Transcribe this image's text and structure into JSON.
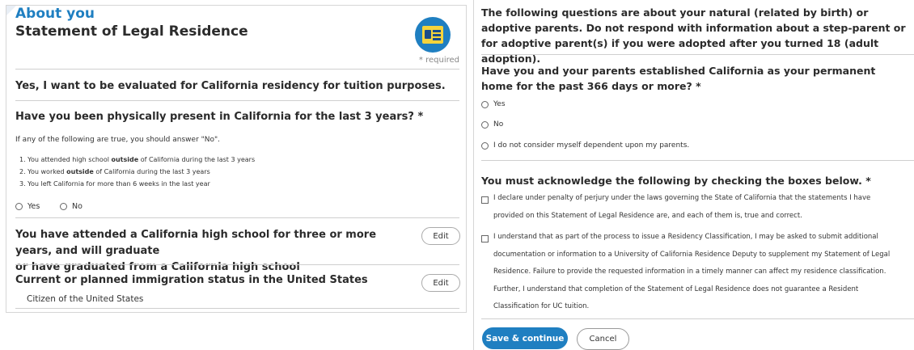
{
  "left": {
    "section_title": "About you",
    "page_title": "Statement of Legal Residence",
    "required_note": "* required",
    "evaluate_text": "Yes, I want to be evaluated for California residency for tuition purposes.",
    "q1": {
      "title": "Have you been physically present in California for the last 3 years? *",
      "hint": "If any of the following are true, you should answer \"No\".",
      "items": [
        {
          "pre": "1. You attended high school ",
          "bold": "outside",
          "post": " of California during the last 3 years"
        },
        {
          "pre": "2. You worked ",
          "bold": "outside",
          "post": " of California during the last 3 years"
        },
        {
          "pre": "3. You left California for more than 6 weeks in the last year",
          "bold": "",
          "post": ""
        }
      ],
      "options": [
        "Yes",
        "No"
      ]
    },
    "q2": {
      "title_line1": "You have attended a California high school for three or more years, and will graduate",
      "title_line2": "or have graduated from a California high school",
      "edit_label": "Edit"
    },
    "q3": {
      "title": "Current or planned immigration status in the United States",
      "answer": "Citizen of the United States",
      "edit_label": "Edit"
    }
  },
  "right": {
    "intro": "The following questions are about your natural (related by birth) or adoptive parents. Do not respond with information about a step-parent or for adoptive parent(s) if you were adopted after you turned 18 (adult adoption).",
    "parents_q": {
      "title": "Have you and your parents established California as your permanent home for the past 366 days or more? *",
      "options": [
        "Yes",
        "No",
        "I do not consider myself dependent upon my parents."
      ]
    },
    "ack": {
      "title": "You must acknowledge the following by checking the boxes below. *",
      "items": [
        "I declare under penalty of perjury under the laws governing the State of California that the statements I have provided on this Statement of Legal Residence are, and each of them is, true and correct.",
        "I understand that as part of the process to issue a Residency Classification, I may be asked to submit additional documentation or information to a University of California Residence Deputy to supplement my Statement of Legal Residence. Failure to provide the requested information in a timely manner can affect my residence classification. Further, I understand that completion of the Statement of Legal Residence does not guarantee a Resident Classification for UC tuition."
      ]
    },
    "buttons": {
      "save": "Save & continue",
      "cancel": "Cancel"
    }
  },
  "icons": {
    "badge": "id-card-icon"
  },
  "colors": {
    "accent": "#1f7fc1",
    "badge_card": "#f5d33b"
  }
}
